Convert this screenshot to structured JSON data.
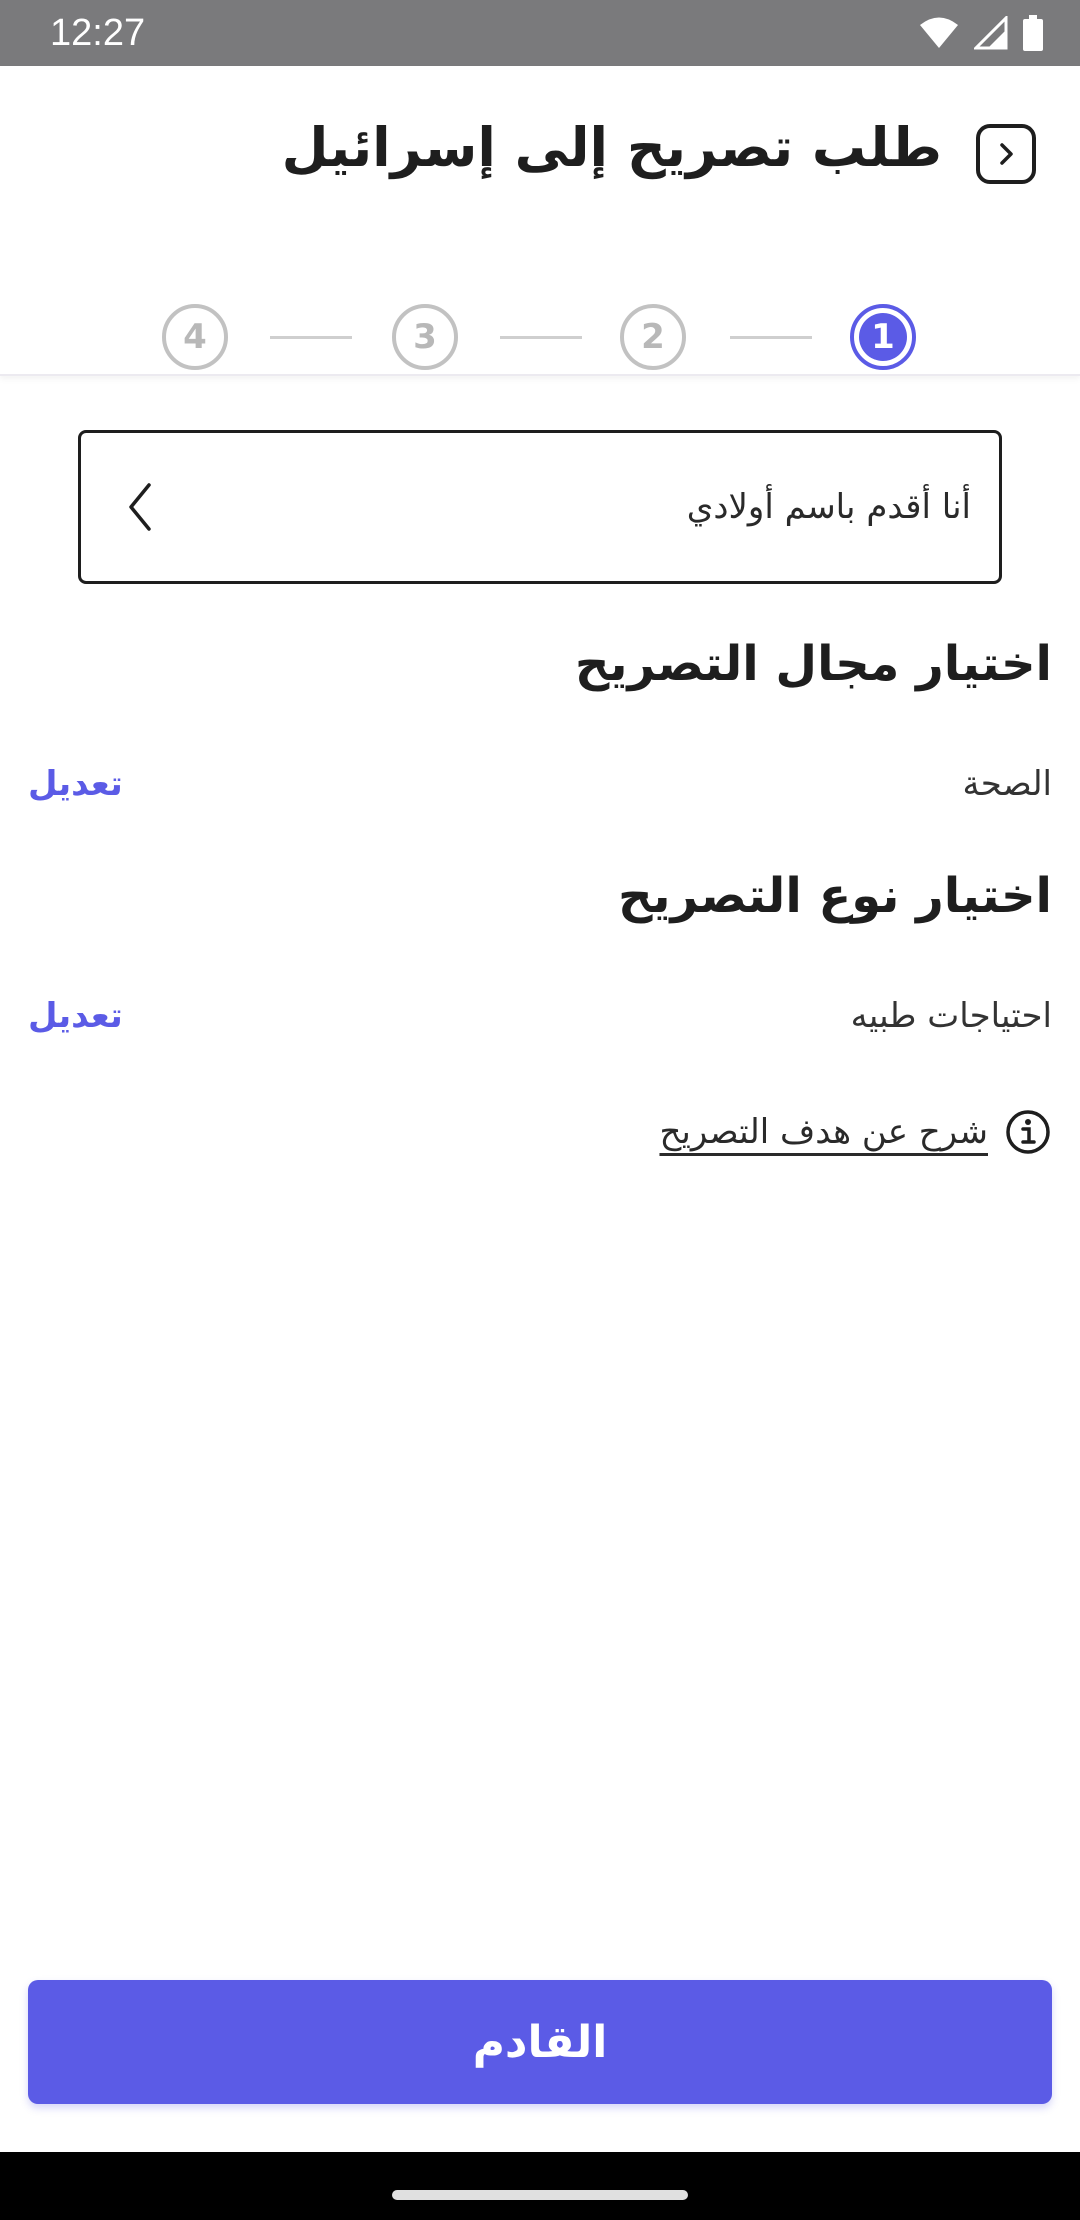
{
  "status_bar": {
    "time": "12:27"
  },
  "header": {
    "title": "طلب تصريح إلى إسرائيل",
    "steps": [
      "1",
      "2",
      "3",
      "4"
    ],
    "active_step": 1
  },
  "selector": {
    "value": "أنا أقدم باسم أولادي"
  },
  "sections": {
    "domain": {
      "title": "اختيار مجال التصريح",
      "value": "الصحة",
      "edit_label": "تعديل"
    },
    "type": {
      "title": "اختيار نوع التصريح",
      "value": "احتياجات طبيه",
      "edit_label": "تعديل"
    }
  },
  "info": {
    "link_label": "شرح عن هدف التصريح"
  },
  "footer": {
    "next_label": "القادم"
  },
  "colors": {
    "accent": "#5b5be6",
    "status_bar": "#7a7a7c",
    "text": "#1e1e1e"
  }
}
